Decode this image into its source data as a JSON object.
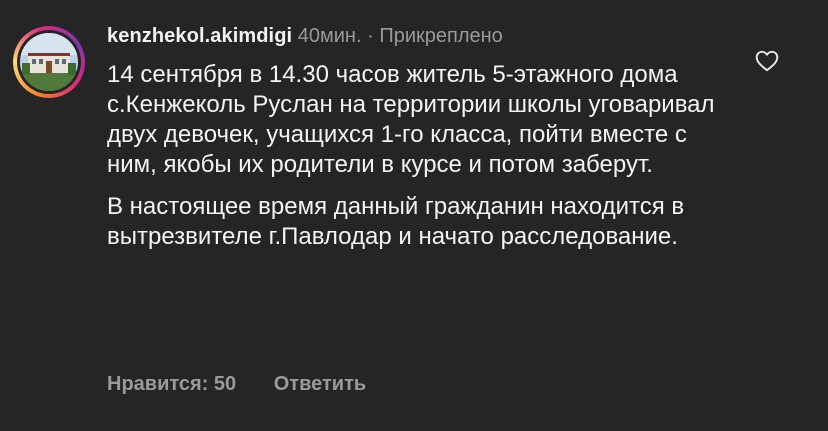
{
  "comment": {
    "username": "kenzhekol.akimdigi",
    "time": "40мин.",
    "separator": " · ",
    "pinned": "Прикреплено",
    "paragraphs": [
      "14 сентября в 14.30 часов житель 5-этажного дома с.Кенжеколь Руслан на территории школы уговаривал двух девочек, учащихся 1-го класса, пойти вместе с ним, якобы их родители в курсе и потом заберут.",
      "В настоящее время данный гражданин находится в вытрезвителе г.Павлодар и начато расследование."
    ],
    "likes_label": "Нравится: 50",
    "reply_label": "Ответить",
    "icons": {
      "like": "heart-outline-icon",
      "avatar_ring": "story-ring"
    }
  },
  "colors": {
    "background": "#252525",
    "text": "#f4f4f4",
    "muted": "#9a9a9a"
  }
}
